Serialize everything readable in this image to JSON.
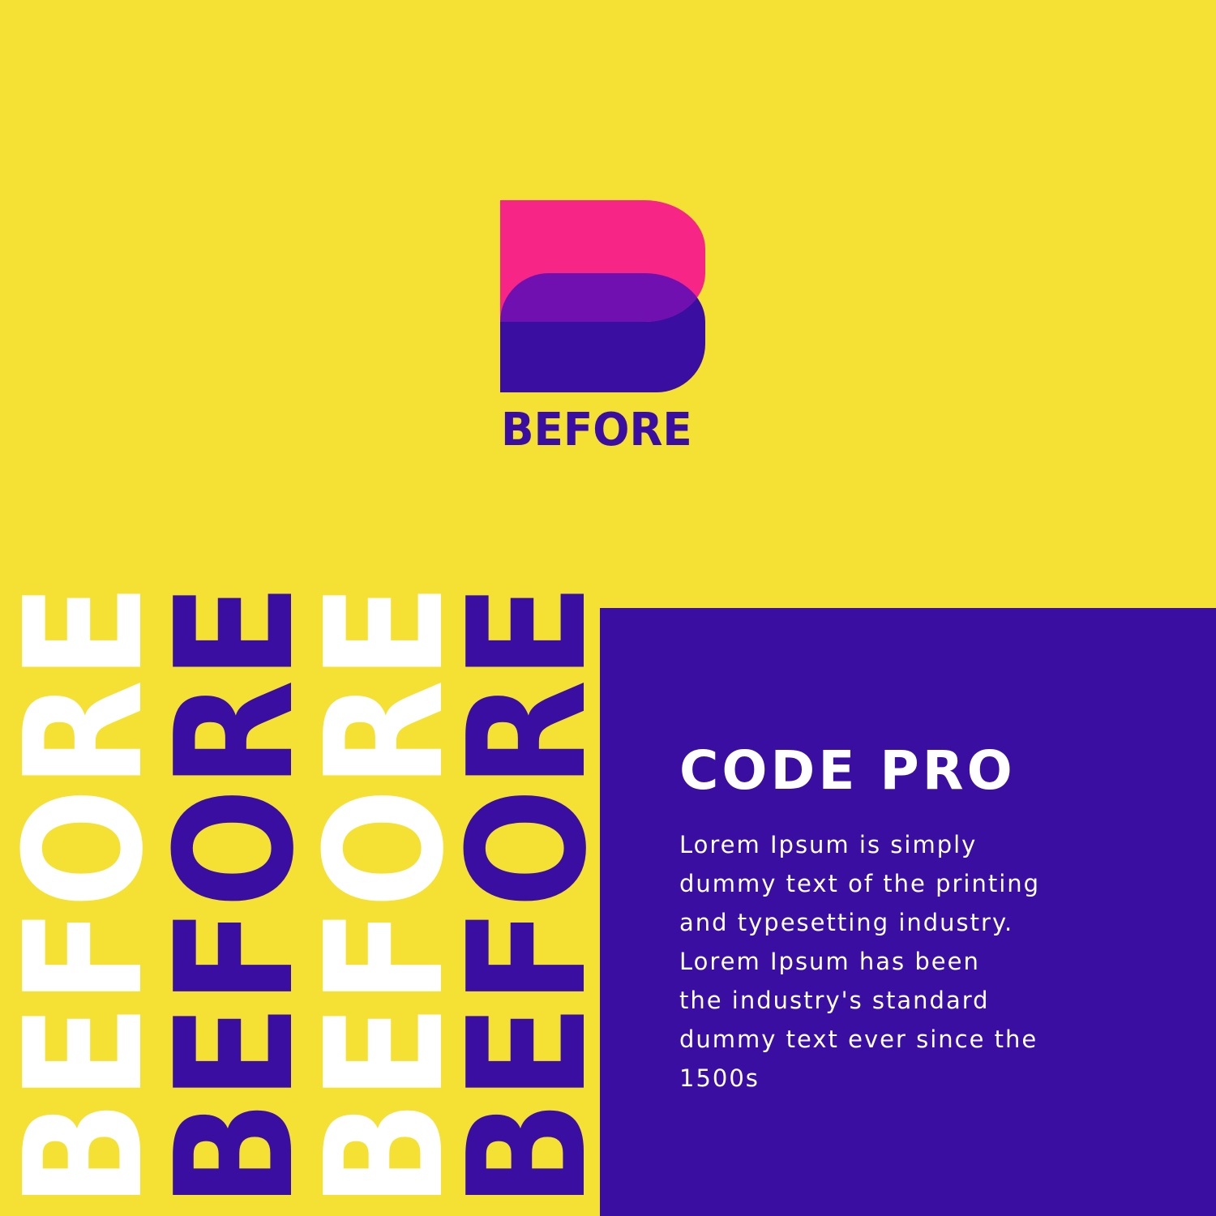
{
  "logo": {
    "name": "BEFORE",
    "colors": {
      "top": "#f72585",
      "overlap": "#7010b0",
      "bottom": "#390ea1"
    }
  },
  "background_color": "#f5e034",
  "panel": {
    "color": "#390ea1",
    "title": "CODE PRO",
    "body_lines": [
      "Lorem Ipsum is simply",
      "dummy text of the printing",
      "and typesetting industry.",
      "Lorem Ipsum has been",
      "the industry's standard",
      "dummy text ever since the",
      "1500s"
    ]
  },
  "vertical_words": [
    {
      "text": "BEFORE",
      "color": "white"
    },
    {
      "text": "BEFORE",
      "color": "purple"
    },
    {
      "text": "BEFORE",
      "color": "white"
    },
    {
      "text": "BEFORE",
      "color": "purple"
    }
  ]
}
